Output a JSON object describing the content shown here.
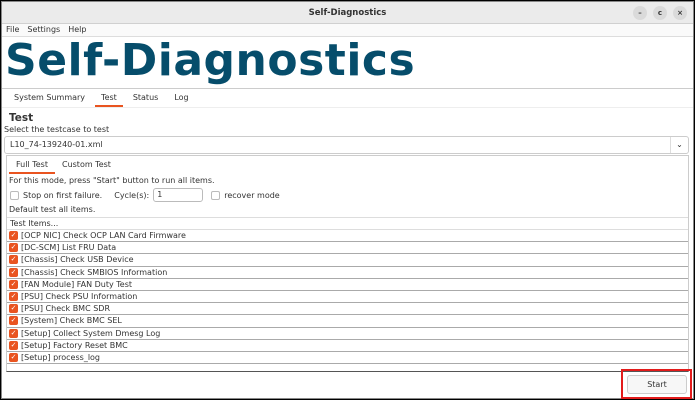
{
  "window": {
    "title": "Self-Diagnostics",
    "controls": [
      "–",
      "c",
      "×"
    ]
  },
  "menu": [
    "File",
    "Settings",
    "Help"
  ],
  "header": {
    "title": "Self-Diagnostics"
  },
  "tabs": [
    {
      "label": "System Summary"
    },
    {
      "label": "Test"
    },
    {
      "label": "Status"
    },
    {
      "label": "Log"
    }
  ],
  "test": {
    "heading": "Test",
    "select_label": "Select the testcase to test",
    "selected": "L10_74-139240-01.xml",
    "arrow": "⌄"
  },
  "subtabs": [
    {
      "label": "Full Test"
    },
    {
      "label": "Custom Test"
    }
  ],
  "full": {
    "hint": "For this mode, press \"Start\" button to run all items.",
    "stop_label": "Stop on first failure.",
    "cycles_label": "Cycle(s):",
    "cycles": "1",
    "recover_label": "recover mode",
    "default_note": "Default test all items.",
    "list_header": "Test Items..."
  },
  "items": [
    "[OCP NIC] Check OCP LAN Card Firmware",
    "[DC-SCM] List FRU Data",
    "[Chassis] Check USB Device",
    "[Chassis] Check SMBIOS Information",
    "[FAN Module] FAN Duty Test",
    "[PSU] Check PSU Information",
    "[PSU] Check BMC SDR",
    "[System] Check BMC SEL",
    "[Setup] Collect System Dmesg Log",
    "[Setup] Factory Reset BMC",
    "[Setup] process_log"
  ],
  "start_label": "Start"
}
